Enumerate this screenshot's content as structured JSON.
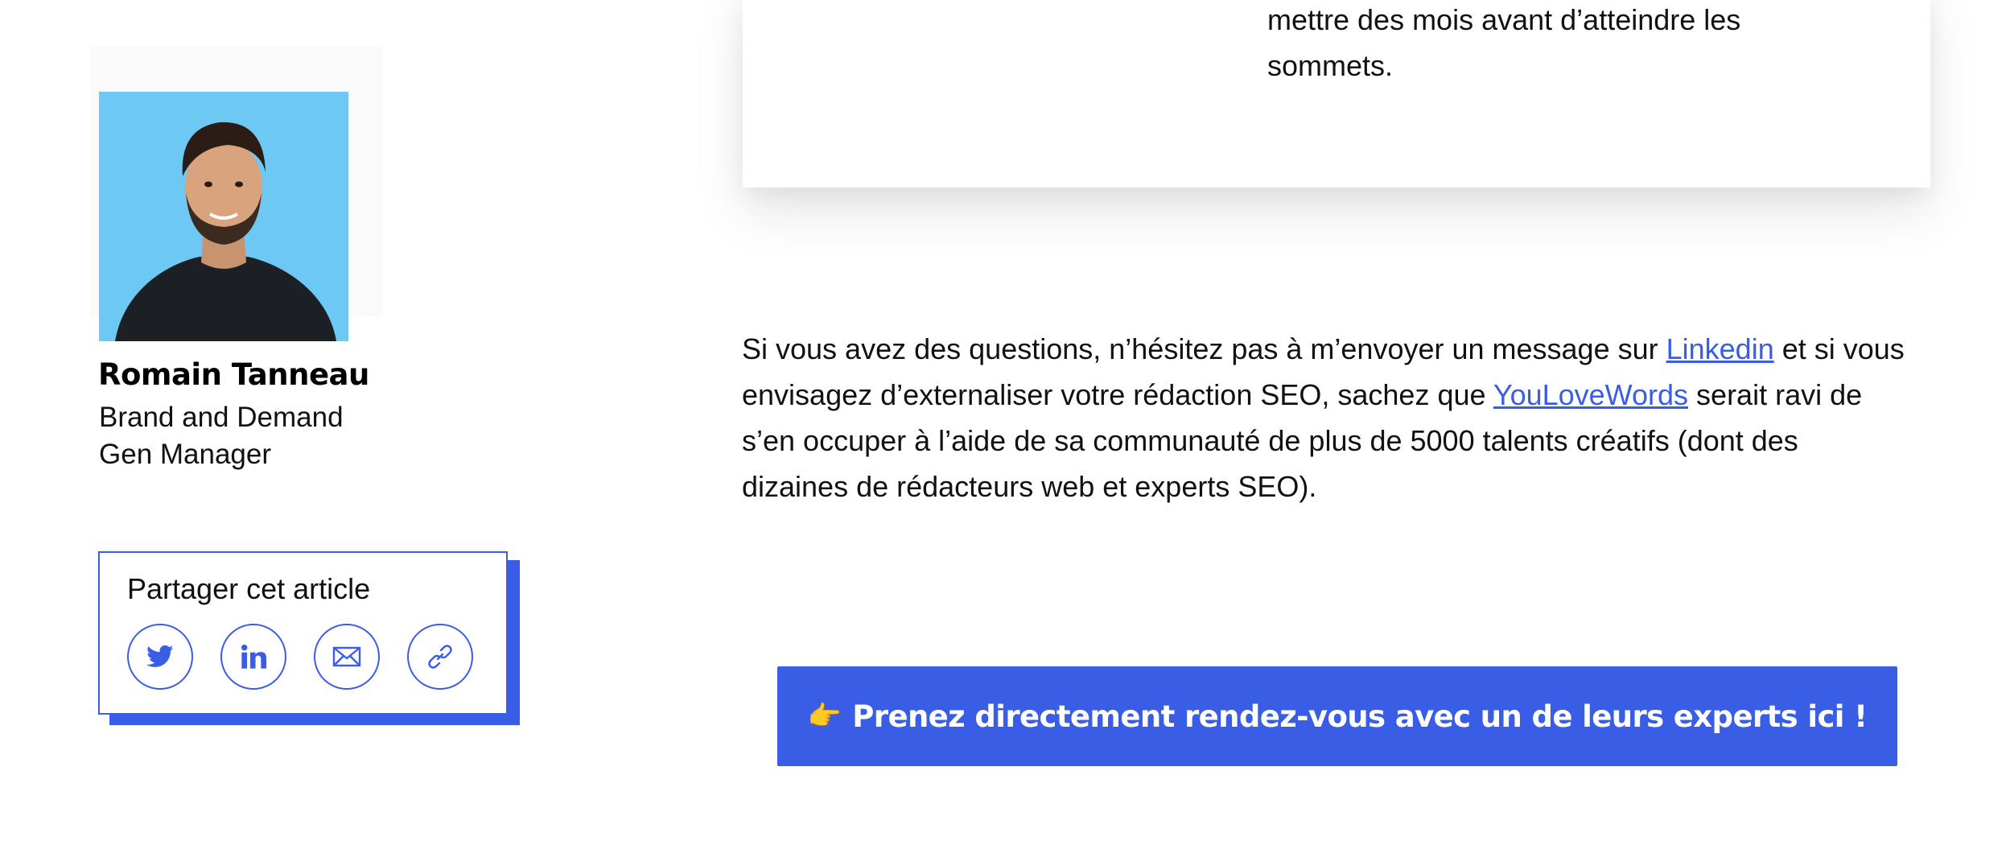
{
  "card": {
    "text": "mettre des mois avant d’atteindre les sommets."
  },
  "author": {
    "name": "Romain Tanneau",
    "role": "Brand and Demand Gen Manager"
  },
  "share": {
    "title": "Partager cet article",
    "buttons": [
      {
        "icon": "twitter-icon"
      },
      {
        "icon": "linkedin-icon"
      },
      {
        "icon": "mail-icon"
      },
      {
        "icon": "link-icon"
      }
    ]
  },
  "paragraph": {
    "part1": "Si vous avez des questions, n’hésitez pas à m’envoyer un message sur ",
    "link1": "Linkedin",
    "part2": " et si vous envisagez d’externaliser votre rédaction SEO, sachez que ",
    "link2": "YouLoveWords",
    "part3": " serait ravi de s’en occuper à l’aide de sa communauté de plus de 5000 talents créatifs (dont des dizaines de rédacteurs web et experts SEO)."
  },
  "cta": {
    "emoji": "👉",
    "label": "Prenez directement rendez-vous avec un de leurs experts ici !"
  },
  "colors": {
    "accent": "#3a5de6",
    "photo_bg": "#6ec8f4"
  }
}
